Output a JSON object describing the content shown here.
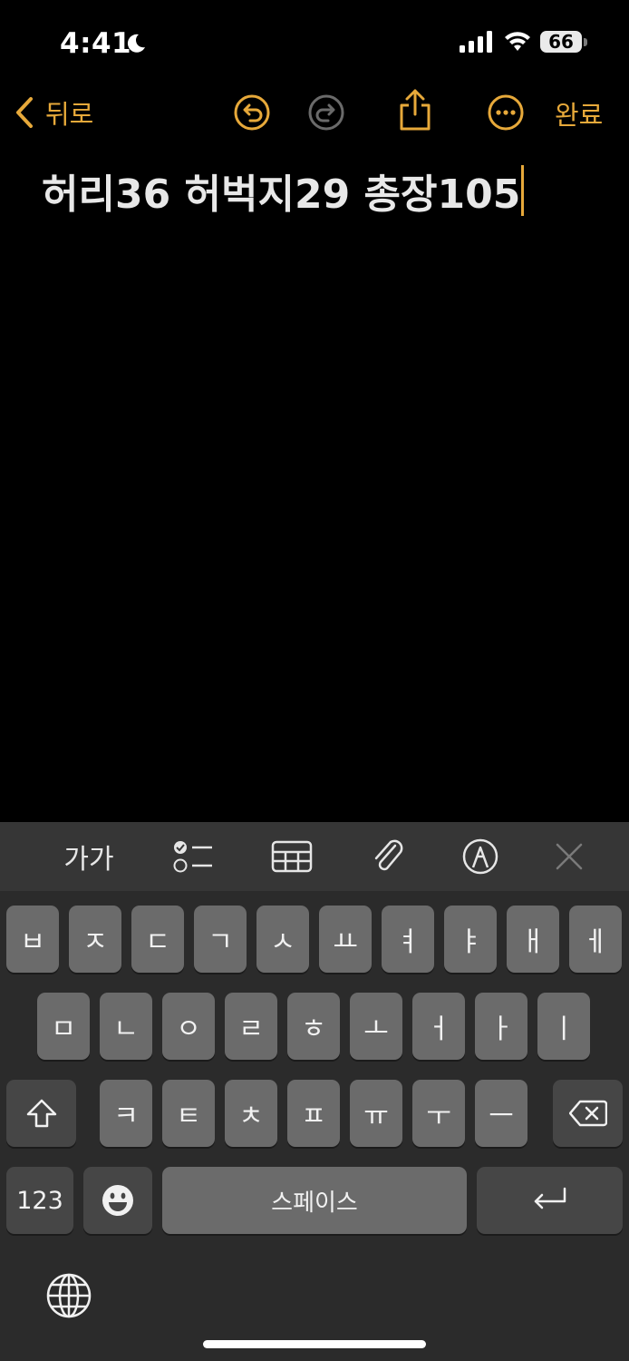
{
  "status_bar": {
    "time": "4:41",
    "battery": "66"
  },
  "nav": {
    "back_label": "뒤로",
    "done_label": "완료"
  },
  "note": {
    "text": "허리36 허벅지29 총장105"
  },
  "toolbar": {
    "text_format_label": "가가"
  },
  "keyboard": {
    "row1": [
      "ㅂ",
      "ㅈ",
      "ㄷ",
      "ㄱ",
      "ㅅ",
      "ㅛ",
      "ㅕ",
      "ㅑ",
      "ㅐ",
      "ㅔ"
    ],
    "row2": [
      "ㅁ",
      "ㄴ",
      "ㅇ",
      "ㄹ",
      "ㅎ",
      "ㅗ",
      "ㅓ",
      "ㅏ",
      "ㅣ"
    ],
    "row3": [
      "ㅋ",
      "ㅌ",
      "ㅊ",
      "ㅍ",
      "ㅠ",
      "ㅜ",
      "ㅡ"
    ],
    "numbers_label": "123",
    "space_label": "스페이스"
  },
  "colors": {
    "accent": "#e7a93a",
    "background": "#000000",
    "keyboard_bg": "#2b2b2b",
    "key": "#6b6b6b",
    "key_dark": "#464646"
  }
}
